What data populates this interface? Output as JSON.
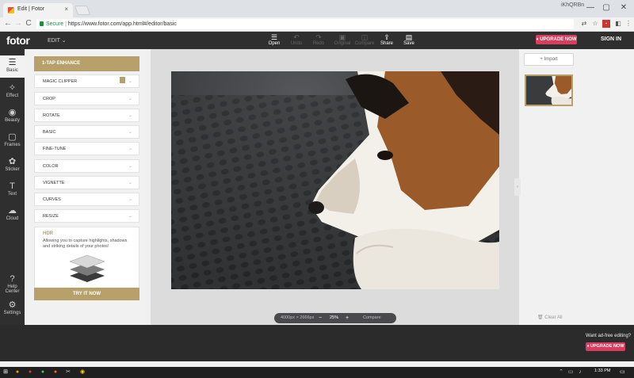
{
  "browser": {
    "tab_title": "Edit | Fotor",
    "tab_close": "×",
    "url_secure": "Secure",
    "url": "https://www.fotor.com/app.html#/editor/basic",
    "user_label": "iKhQRBn",
    "nav_back": "←",
    "nav_forward": "→",
    "nav_reload": "C"
  },
  "app": {
    "logo": "fotor",
    "mode": "EDIT ⌄",
    "toolbar": [
      {
        "label": "Open",
        "icon": "☰"
      },
      {
        "label": "Undo",
        "icon": "↶"
      },
      {
        "label": "Redo",
        "icon": "↷"
      },
      {
        "label": "Original",
        "icon": "▣"
      },
      {
        "label": "Compare",
        "icon": "◫"
      },
      {
        "label": "Share",
        "icon": "⇪"
      },
      {
        "label": "Save",
        "icon": "▤"
      }
    ],
    "upgrade": "UPGRADE NOW",
    "sign_in": "SIGN IN"
  },
  "rail": [
    {
      "label": "Basic",
      "icon": "☰"
    },
    {
      "label": "Effect",
      "icon": "✧"
    },
    {
      "label": "Beauty",
      "icon": "◉"
    },
    {
      "label": "Frames",
      "icon": "▢"
    },
    {
      "label": "Sticker",
      "icon": "✿"
    },
    {
      "label": "Text",
      "icon": "T"
    },
    {
      "label": "Cloud",
      "icon": "☁"
    },
    {
      "label": "Help Center",
      "icon": "?"
    },
    {
      "label": "Settings",
      "icon": "⚙"
    }
  ],
  "panel": {
    "one_tap": "1-TAP ENHANCE",
    "sections": [
      "MAGIC CLIPPER",
      "CROP",
      "ROTATE",
      "BASIC",
      "FINE-TUNE",
      "COLOR",
      "VIGNETTE",
      "CURVES",
      "RESIZE"
    ],
    "chevron": "⌄",
    "hdr_title": "HDR",
    "hdr_desc": "Allowing you to capture highlights, shadows and striking details of your photos!",
    "try_now": "TRY IT NOW"
  },
  "canvas": {
    "size": "4000px × 2666px",
    "zoom_minus": "−",
    "zoom": "25%",
    "zoom_plus": "+",
    "compare": "Compare"
  },
  "right": {
    "import": "+ Import",
    "clear_all": "Clear All",
    "collapse": "›"
  },
  "ad": {
    "text": "Want ad-free editing?",
    "upgrade": "UPGRADE NOW"
  },
  "taskbar": {
    "clock": "1:33 PM",
    "notif": "▭"
  },
  "colors": {
    "accent_gold": "#b8a06a",
    "upgrade_pink": "#d93d5e",
    "dark_bar": "#2f2f30"
  }
}
